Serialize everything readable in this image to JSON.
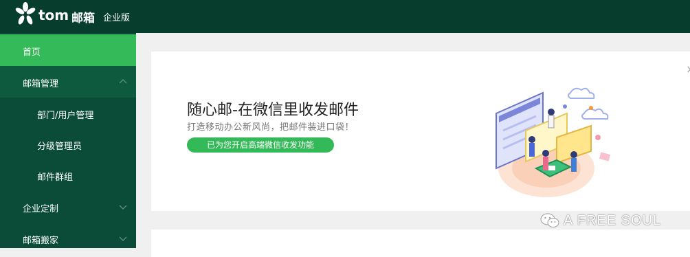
{
  "header": {
    "logo_text": "tom",
    "brand_cn": "邮箱",
    "edition": "企业版"
  },
  "sidebar": {
    "items": [
      {
        "label": "首页",
        "state": "active"
      },
      {
        "label": "邮箱管理",
        "state": "expanded"
      },
      {
        "label": "部门/用户管理",
        "state": "sub"
      },
      {
        "label": "分级管理员",
        "state": "sub"
      },
      {
        "label": "邮件群组",
        "state": "sub"
      },
      {
        "label": "企业定制",
        "state": "collapsed"
      },
      {
        "label": "邮箱搬家",
        "state": "collapsed"
      }
    ]
  },
  "promo": {
    "title": "随心邮-在微信里收发邮件",
    "subtitle": "打造移动办公新风尚，把邮件装进口袋！",
    "button_label": "已为您开启高端微信收发功能",
    "close_icon": "×"
  },
  "watermark": {
    "text": "A FREE SOUL"
  },
  "colors": {
    "topbar": "#063d2c",
    "sidebar": "#0a4c37",
    "active": "#34ba58",
    "accent": "#33b957"
  }
}
